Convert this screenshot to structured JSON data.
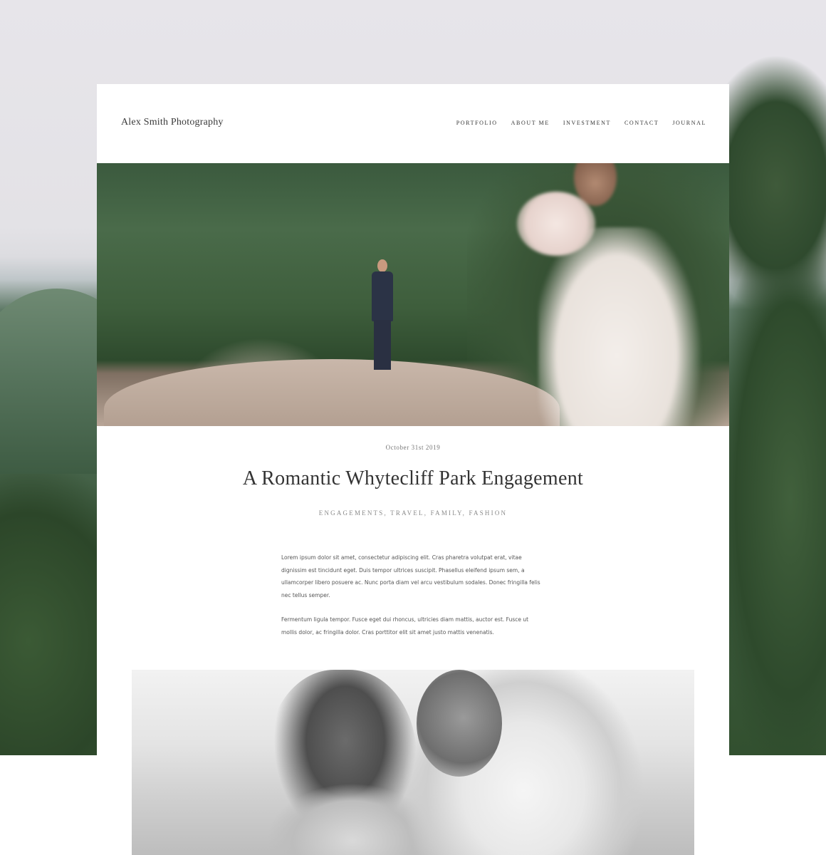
{
  "site": {
    "brand": "Alex Smith Photography"
  },
  "nav": {
    "items": [
      {
        "label": "PORTFOLIO"
      },
      {
        "label": "ABOUT ME"
      },
      {
        "label": "INVESTMENT"
      },
      {
        "label": "CONTACT"
      },
      {
        "label": "JOURNAL"
      }
    ]
  },
  "post": {
    "date": "October 31st 2019",
    "title": "A Romantic Whytecliff Park Engagement",
    "tags": "ENGAGEMENTS, TRAVEL, FAMILY, FASHION",
    "paragraphs": [
      "Lorem ipsum dolor sit amet, consectetur adipiscing elit. Cras pharetra volutpat erat, vitae dignissim est tincidunt eget. Duis tempor ultrices suscipit. Phasellus eleifend ipsum sem, a ullamcorper libero posuere ac. Nunc porta diam vel arcu vestibulum sodales. Donec fringilla felis nec tellus semper.",
      "Fermentum ligula tempor. Fusce eget dui rhoncus, ultricies diam mattis, auctor est. Fusce ut mollis dolor, ac fringilla dolor. Cras porttitor elit sit amet justo mattis venenatis."
    ]
  },
  "colors": {
    "text_dark": "#333333",
    "text_muted": "#8a8a8a",
    "card_bg": "#ffffff"
  }
}
